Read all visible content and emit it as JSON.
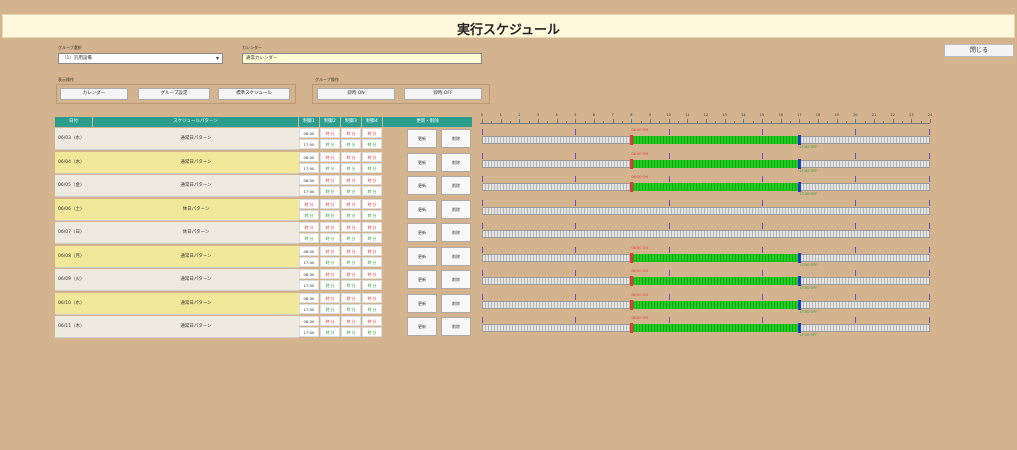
{
  "title": "実行スケジュール",
  "close_button": "閉じる",
  "group_select": {
    "label": "グループ選択",
    "value": "（1）汎用設備"
  },
  "calendar": {
    "label": "カレンダー",
    "value": "通常カレンダー"
  },
  "display_ops": {
    "label": "表示操作",
    "buttons": [
      "カレンダー",
      "グループ設定",
      "標準スケジュール"
    ]
  },
  "group_ops": {
    "label": "グループ操作",
    "buttons": [
      "即時 ON",
      "即時 OFF"
    ]
  },
  "table": {
    "headers": [
      "日付",
      "スケジュールパターン",
      "制御1",
      "制御2",
      "制御3",
      "制御4",
      "更新・削除"
    ],
    "update_label": "更新",
    "delete_label": "削除"
  },
  "rows": [
    {
      "date": "06/03（水）",
      "pattern": "通常日パターン",
      "slots": [
        [
          "08:00",
          "17:00"
        ],
        [
          "時 分",
          "時 分"
        ],
        [
          "時 分",
          "時 分"
        ],
        [
          "時 分",
          "時 分"
        ]
      ],
      "on": "08:00",
      "off": "17:00",
      "has_schedule": true,
      "highlight": false
    },
    {
      "date": "06/04（木）",
      "pattern": "通常日パターン",
      "slots": [
        [
          "08:00",
          "17:00"
        ],
        [
          "時 分",
          "時 分"
        ],
        [
          "時 分",
          "時 分"
        ],
        [
          "時 分",
          "時 分"
        ]
      ],
      "on": "08:00",
      "off": "17:00",
      "has_schedule": true,
      "highlight": true
    },
    {
      "date": "06/05（金）",
      "pattern": "通常日パターン",
      "slots": [
        [
          "08:00",
          "17:00"
        ],
        [
          "時 分",
          "時 分"
        ],
        [
          "時 分",
          "時 分"
        ],
        [
          "時 分",
          "時 分"
        ]
      ],
      "on": "08:00",
      "off": "17:00",
      "has_schedule": true,
      "highlight": false
    },
    {
      "date": "06/06（土）",
      "pattern": "休日パターン",
      "slots": [
        [
          "時 分",
          "時 分"
        ],
        [
          "時 分",
          "時 分"
        ],
        [
          "時 分",
          "時 分"
        ],
        [
          "時 分",
          "時 分"
        ]
      ],
      "on": "",
      "off": "",
      "has_schedule": false,
      "highlight": true
    },
    {
      "date": "06/07（日）",
      "pattern": "休日パターン",
      "slots": [
        [
          "時 分",
          "時 分"
        ],
        [
          "時 分",
          "時 分"
        ],
        [
          "時 分",
          "時 分"
        ],
        [
          "時 分",
          "時 分"
        ]
      ],
      "on": "",
      "off": "",
      "has_schedule": false,
      "highlight": false
    },
    {
      "date": "06/08（月）",
      "pattern": "通常日パターン",
      "slots": [
        [
          "08:00",
          "17:00"
        ],
        [
          "時 分",
          "時 分"
        ],
        [
          "時 分",
          "時 分"
        ],
        [
          "時 分",
          "時 分"
        ]
      ],
      "on": "08:00",
      "off": "17:00",
      "has_schedule": true,
      "highlight": true
    },
    {
      "date": "06/09（火）",
      "pattern": "通常日パターン",
      "slots": [
        [
          "08:00",
          "17:00"
        ],
        [
          "時 分",
          "時 分"
        ],
        [
          "時 分",
          "時 分"
        ],
        [
          "時 分",
          "時 分"
        ]
      ],
      "on": "08:00",
      "off": "17:00",
      "has_schedule": true,
      "highlight": false
    },
    {
      "date": "06/10（水）",
      "pattern": "通常日パターン",
      "slots": [
        [
          "08:00",
          "17:00"
        ],
        [
          "時 分",
          "時 分"
        ],
        [
          "時 分",
          "時 分"
        ],
        [
          "時 分",
          "時 分"
        ]
      ],
      "on": "08:00",
      "off": "17:00",
      "has_schedule": true,
      "highlight": true
    },
    {
      "date": "06/11（木）",
      "pattern": "通常日パターン",
      "slots": [
        [
          "08:00",
          "17:00"
        ],
        [
          "時 分",
          "時 分"
        ],
        [
          "時 分",
          "時 分"
        ],
        [
          "時 分",
          "時 分"
        ]
      ],
      "on": "08:00",
      "off": "17:00",
      "has_schedule": true,
      "highlight": false
    }
  ],
  "timeline": {
    "hours": [
      "0",
      "1",
      "2",
      "3",
      "4",
      "5",
      "6",
      "7",
      "8",
      "9",
      "10",
      "11",
      "12",
      "13",
      "14",
      "15",
      "16",
      "17",
      "18",
      "19",
      "20",
      "21",
      "22",
      "23",
      "24"
    ],
    "on_label": "08:00 ON",
    "off_label": "17:00 OFF"
  },
  "colors": {
    "background": "#d4b48e",
    "header_teal": "#2a9d8f",
    "row_highlight": "#f2e89a",
    "row_normal": "#eeeae0",
    "on_green": "#22cc22",
    "on_marker": "#e53935",
    "off_marker": "#1a3cc9"
  }
}
